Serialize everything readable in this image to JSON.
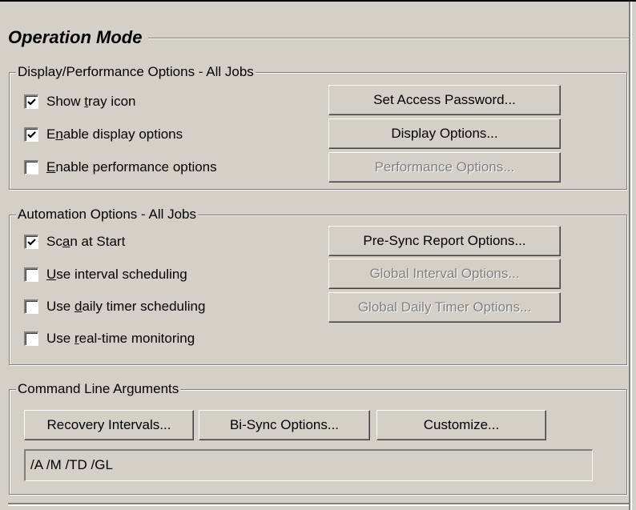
{
  "title": "Operation Mode",
  "display_group": {
    "label": "Display/Performance Options - All Jobs",
    "checkboxes": [
      {
        "pre": "Show ",
        "key": "t",
        "post": "ray icon",
        "checked": true
      },
      {
        "pre": "E",
        "key": "n",
        "post": "able display options",
        "checked": true
      },
      {
        "pre": "",
        "key": "E",
        "post": "nable performance options",
        "checked": false
      }
    ],
    "buttons": [
      {
        "label": "Set Access Password...",
        "enabled": true
      },
      {
        "label": "Display Options...",
        "enabled": true
      },
      {
        "label": "Performance Options...",
        "enabled": false
      }
    ]
  },
  "automation_group": {
    "label": "Automation Options - All Jobs",
    "checkboxes": [
      {
        "pre": "Sc",
        "key": "a",
        "post": "n at Start",
        "checked": true
      },
      {
        "pre": "",
        "key": "U",
        "post": "se interval scheduling",
        "checked": false
      },
      {
        "pre": "Use ",
        "key": "d",
        "post": "aily timer scheduling",
        "checked": false
      },
      {
        "pre": "Use ",
        "key": "r",
        "post": "eal-time monitoring",
        "checked": false
      }
    ],
    "buttons": [
      {
        "label": "Pre-Sync Report Options...",
        "enabled": true
      },
      {
        "label": "Global Interval Options...",
        "enabled": false
      },
      {
        "label": "Global Daily Timer Options...",
        "enabled": false
      }
    ]
  },
  "command_group": {
    "label": "Command Line Arguments",
    "buttons": [
      {
        "label": "Recovery Intervals..."
      },
      {
        "label": "Bi-Sync Options..."
      },
      {
        "label": "Customize..."
      }
    ],
    "arguments": "/A /M /TD /GL"
  }
}
